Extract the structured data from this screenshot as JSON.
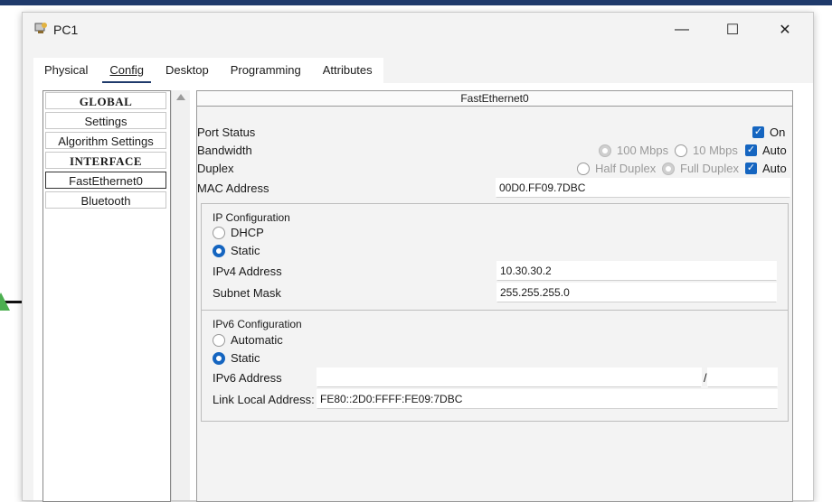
{
  "window": {
    "title": "PC1",
    "icon": "pc-icon"
  },
  "controls": {
    "minimize": "—",
    "maximize": "☐",
    "close": "✕"
  },
  "tabs": [
    {
      "label": "Physical"
    },
    {
      "label": "Config"
    },
    {
      "label": "Desktop"
    },
    {
      "label": "Programming"
    },
    {
      "label": "Attributes"
    }
  ],
  "sidebar": {
    "global": "GLOBAL",
    "settings": "Settings",
    "algorithm": "Algorithm Settings",
    "interface": "INTERFACE",
    "fe0": "FastEthernet0",
    "bluetooth": "Bluetooth"
  },
  "interface": {
    "header": "FastEthernet0",
    "port_status_label": "Port Status",
    "port_status_on": "On",
    "bandwidth_label": "Bandwidth",
    "bw_100": "100 Mbps",
    "bw_10": "10 Mbps",
    "bw_auto": "Auto",
    "duplex_label": "Duplex",
    "half_duplex": "Half Duplex",
    "full_duplex": "Full Duplex",
    "duplex_auto": "Auto",
    "mac_label": "MAC Address",
    "mac_value": "00D0.FF09.7DBC"
  },
  "ipv4": {
    "title": "IP Configuration",
    "dhcp": "DHCP",
    "static": "Static",
    "addr_label": "IPv4 Address",
    "addr_value": "10.30.30.2",
    "mask_label": "Subnet Mask",
    "mask_value": "255.255.255.0"
  },
  "ipv6": {
    "title": "IPv6 Configuration",
    "automatic": "Automatic",
    "static": "Static",
    "addr_label": "IPv6 Address",
    "addr_value": "",
    "slash": "/",
    "prefix_value": "",
    "link_local_label": "Link Local Address:",
    "link_local_value": "FE80::2D0:FFFF:FE09:7DBC"
  },
  "colors": {
    "accent": "#1565c0",
    "tab_underline": "#1f3a6b"
  }
}
